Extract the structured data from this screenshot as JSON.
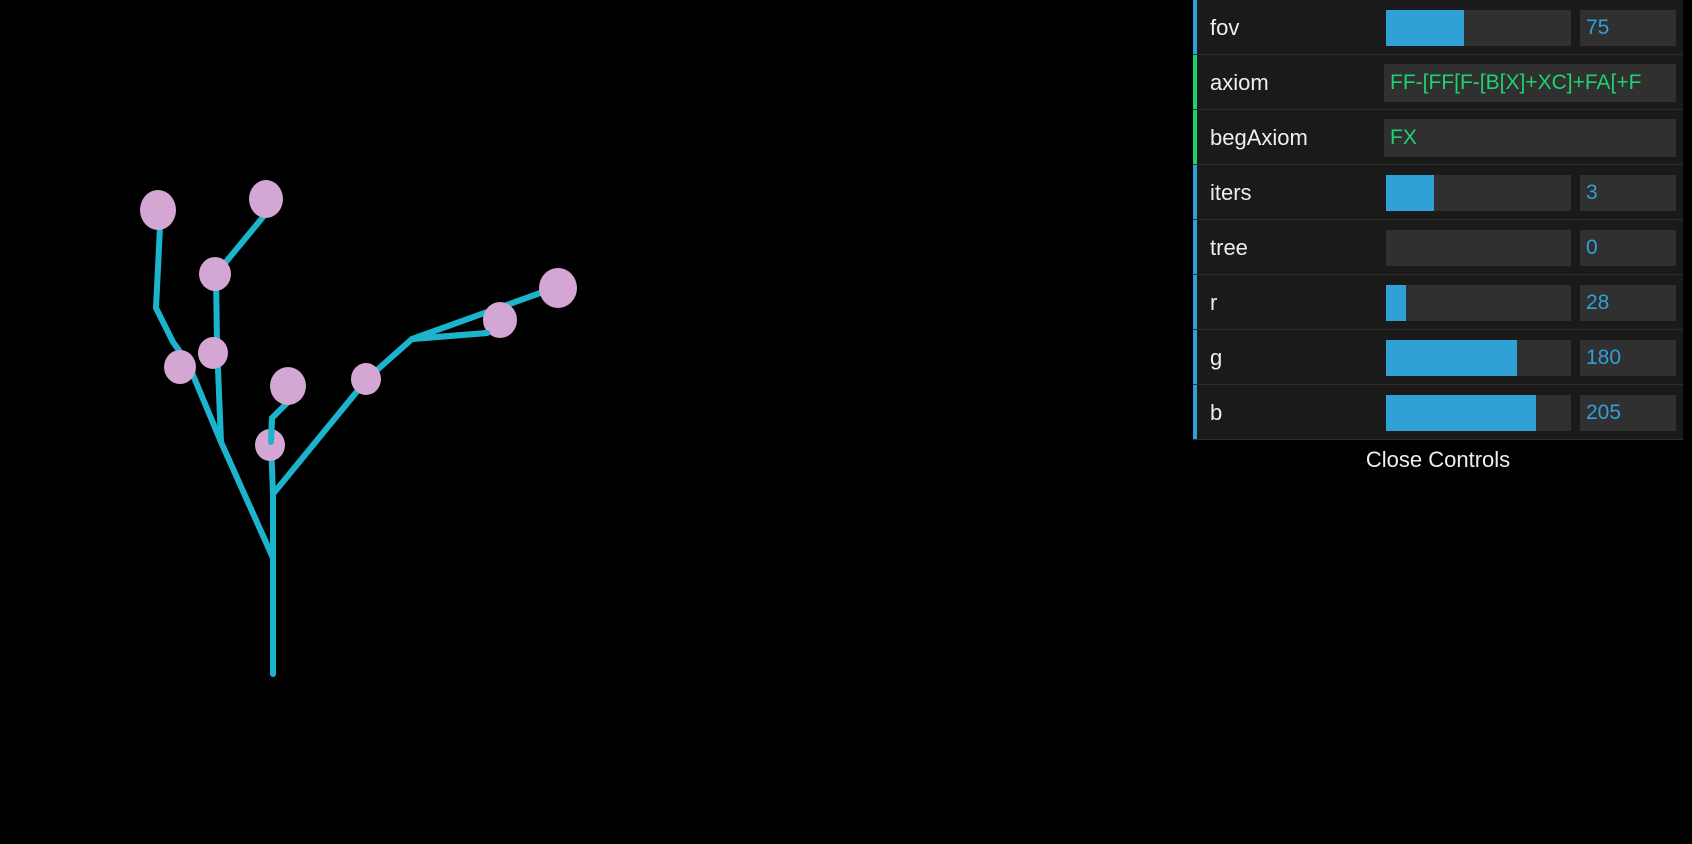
{
  "scene": {
    "background_color": "#000000",
    "branch_color": "#1cb4cd",
    "leaf_color": "#d3a6d3"
  },
  "controls": {
    "fov": {
      "label": "fov",
      "value": "75",
      "fill_fraction": 0.42
    },
    "axiom": {
      "label": "axiom",
      "value": "FF-[FF[F-[B[X]+XC]+FA[+F"
    },
    "begAxiom": {
      "label": "begAxiom",
      "value": "FX"
    },
    "iters": {
      "label": "iters",
      "value": "3",
      "fill_fraction": 0.26
    },
    "tree": {
      "label": "tree",
      "value": "0",
      "fill_fraction": 0.0
    },
    "r": {
      "label": "r",
      "value": "28",
      "fill_fraction": 0.11
    },
    "g": {
      "label": "g",
      "value": "180",
      "fill_fraction": 0.71
    },
    "b": {
      "label": "b",
      "value": "205",
      "fill_fraction": 0.81
    },
    "close_label": "Close Controls"
  },
  "colors": {
    "number_accent": "#2fa1d6",
    "string_accent": "#1ed36f",
    "panel_background": "#1a1a1a",
    "field_background": "#303030"
  }
}
